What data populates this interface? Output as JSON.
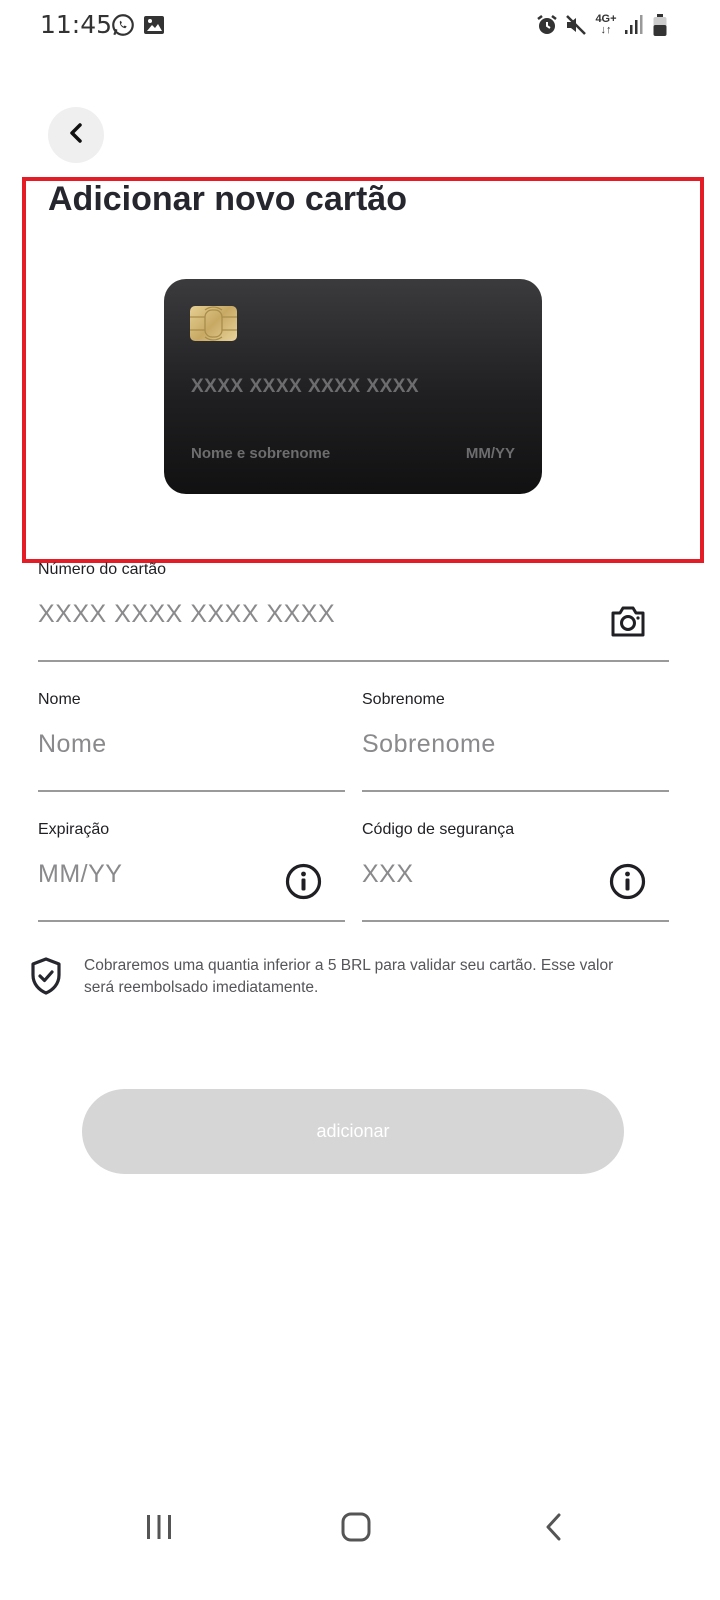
{
  "status_bar": {
    "time": "11:45",
    "network": "4G+",
    "icons": [
      "whatsapp-icon",
      "gallery-icon",
      "alarm-icon",
      "mute-icon",
      "network-4g-icon",
      "signal-icon",
      "battery-icon"
    ]
  },
  "header": {
    "back_icon": "chevron-left-icon",
    "title": "Adicionar novo cartão"
  },
  "card_preview": {
    "number": "XXXX XXXX XXXX XXXX",
    "holder": "Nome e sobrenome",
    "expiry": "MM/YY"
  },
  "form": {
    "card_number": {
      "label": "Número do cartão",
      "placeholder": "XXXX XXXX XXXX XXXX",
      "value": "",
      "icon": "camera-icon"
    },
    "first_name": {
      "label": "Nome",
      "placeholder": "Nome",
      "value": ""
    },
    "last_name": {
      "label": "Sobrenome",
      "placeholder": "Sobrenome",
      "value": ""
    },
    "expiry": {
      "label": "Expiração",
      "placeholder": "MM/YY",
      "value": "",
      "icon": "info-icon"
    },
    "cvv": {
      "label": "Código de segurança",
      "placeholder": "XXX",
      "value": "",
      "icon": "info-icon"
    }
  },
  "notice": {
    "icon": "shield-check-icon",
    "text": "Cobraremos uma quantia inferior a 5 BRL para validar seu cartão. Esse valor será reembolsado imediatamente."
  },
  "submit": {
    "label": "adicionar",
    "enabled": false
  },
  "colors": {
    "highlight": "#e31c25",
    "button_disabled": "#d6d6d6",
    "card_dark": "#1f1f21",
    "chip_gold": "#c7a964",
    "text_primary": "#26262f"
  },
  "nav_bar": {
    "icons": [
      "recent-apps-icon",
      "home-icon",
      "back-icon"
    ]
  }
}
